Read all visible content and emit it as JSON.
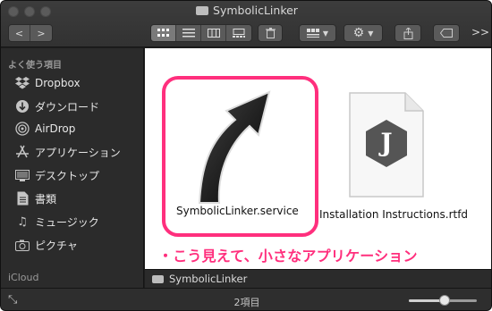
{
  "window": {
    "title": "SymbolicLinker"
  },
  "toolbar": {
    "back_label": "<",
    "forward_label": ">",
    "more_label": ">>"
  },
  "sidebar": {
    "favorites_heading": "よく使う項目",
    "items": [
      {
        "label": "Dropbox",
        "icon": "dropbox-icon"
      },
      {
        "label": "ダウンロード",
        "icon": "download-icon"
      },
      {
        "label": "AirDrop",
        "icon": "airdrop-icon"
      },
      {
        "label": "アプリケーション",
        "icon": "applications-icon"
      },
      {
        "label": "デスクトップ",
        "icon": "desktop-icon"
      },
      {
        "label": "書類",
        "icon": "documents-icon"
      },
      {
        "label": "ミュージック",
        "icon": "music-icon"
      },
      {
        "label": "ピクチャ",
        "icon": "pictures-icon"
      }
    ],
    "icloud_heading": "iCloud"
  },
  "files": [
    {
      "name": "SymbolicLinker.service",
      "icon": "service-arrow-icon"
    },
    {
      "name": "Installation Instructions.rtfd",
      "icon": "rtfd-document-icon",
      "glyph": "J"
    }
  ],
  "annotation": "・こう見えて、小さなアプリケーション",
  "pathbar": {
    "label": "SymbolicLinker"
  },
  "status": {
    "item_count": "2項目"
  },
  "colors": {
    "highlight": "#ff2f7d",
    "window_bg": "#1e1e1e"
  }
}
